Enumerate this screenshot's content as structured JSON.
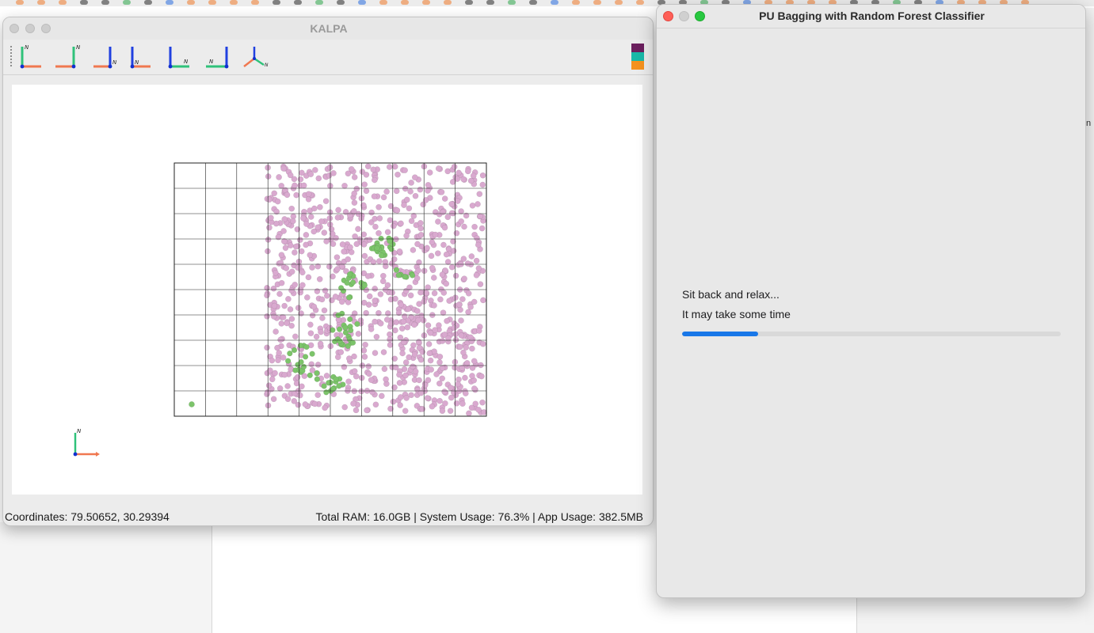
{
  "kalpa": {
    "title": "KALPA",
    "status": {
      "coordinates": "Coordinates: 79.50652, 30.29394",
      "memory": "Total RAM: 16.0GB | System Usage: 76.3% | App Usage: 382.5MB"
    },
    "axis_label": "N",
    "toolbar_icons": [
      "view-north-up-icon",
      "view-north-up-reversed-icon",
      "view-down-north-icon",
      "view-north-tilted-icon",
      "view-up-east-icon",
      "view-up-west-icon",
      "view-3d-axes-icon"
    ],
    "legend_colors": [
      "#6b1f5e",
      "#19b8a8",
      "#f5921e"
    ],
    "map": {
      "grid_columns": 10,
      "grid_rows": 10,
      "background_point_color": "#d9a9cf",
      "positive_point_color": "#7cc46a",
      "grid_line_color": "#222222"
    }
  },
  "pu_dialog": {
    "title": "PU Bagging with Random Forest Classifier",
    "message_line1": "Sit back and relax...",
    "message_line2": "It may take some time",
    "progress": 0.2,
    "accent_color": "#1877e8"
  },
  "background": {
    "right_strip_fragments": [
      "n"
    ]
  }
}
